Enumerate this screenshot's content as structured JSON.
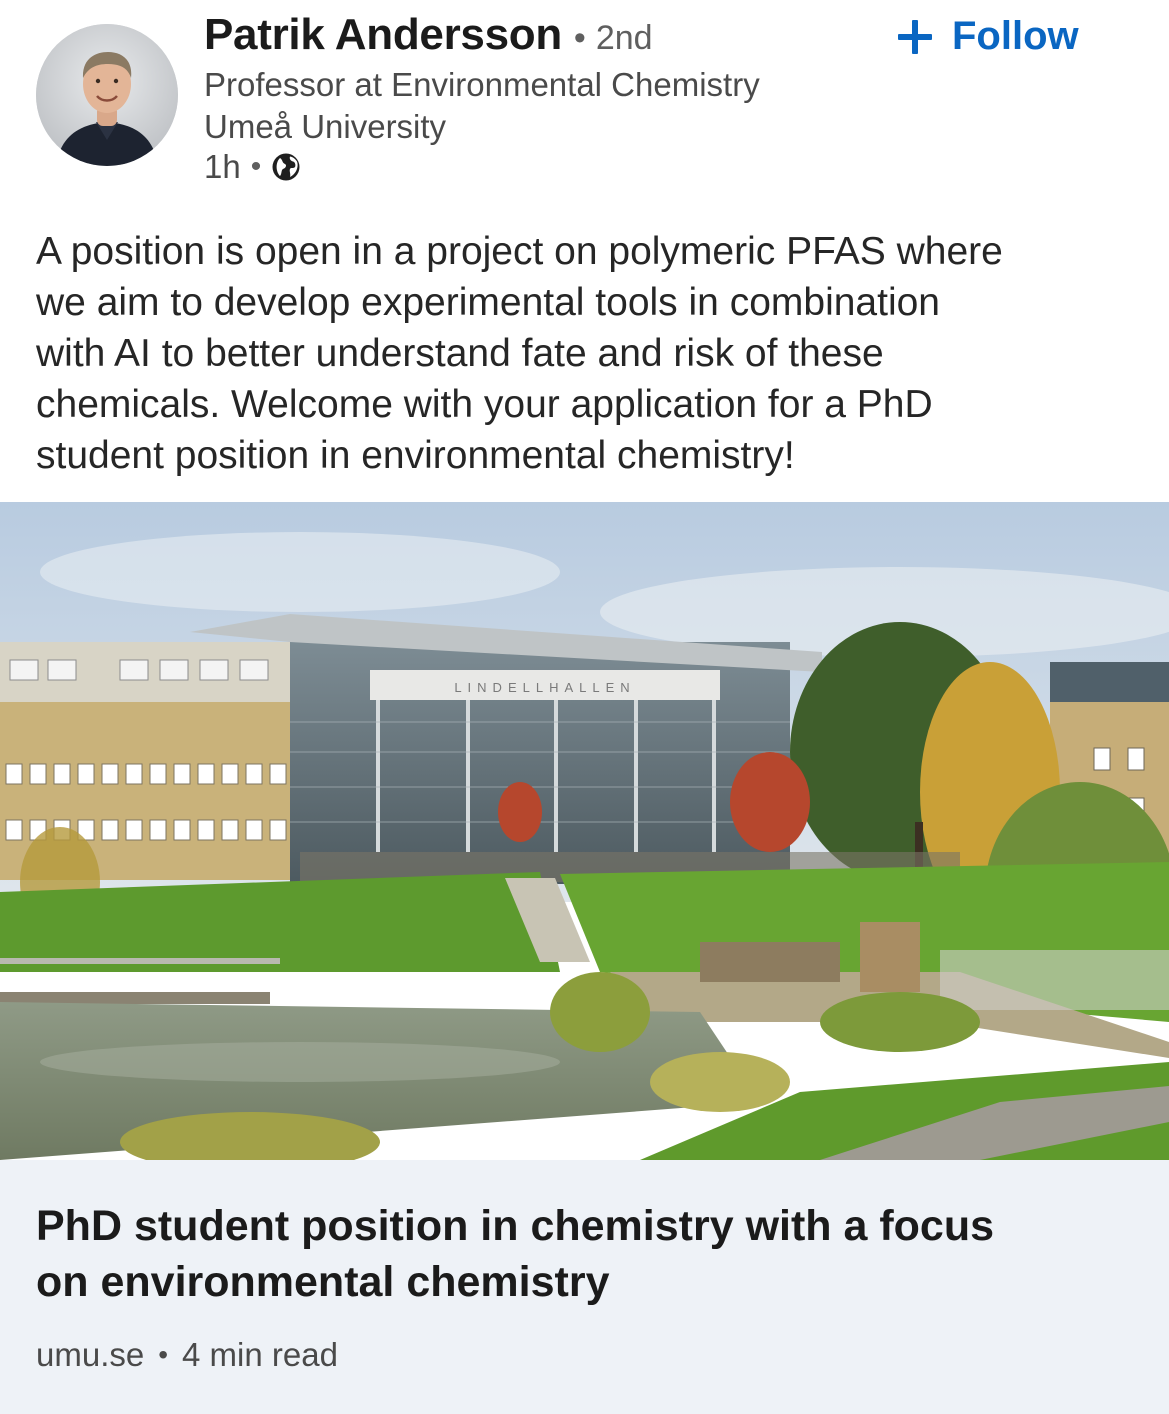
{
  "author": {
    "name": "Patrik Andersson",
    "connection_degree": "2nd",
    "headline_lines": [
      "Professor at Environmental Chemistry",
      "Umeå University"
    ],
    "time_ago": "1h",
    "visibility_icon": "globe-icon"
  },
  "follow_button": {
    "label": "Follow",
    "icon": "plus-icon",
    "color": "#0a66c2"
  },
  "post": {
    "text_lines": [
      "A position is open in a project on polymeric PFAS where",
      "we aim to develop experimental tools in combination",
      "with AI to better understand fate and risk of these",
      "chemicals. Welcome with your application for a PhD",
      "student position in environmental chemistry!"
    ],
    "image_sign_text": "LINDELLHALLEN"
  },
  "link_card": {
    "title_lines": [
      "PhD student position in chemistry with a focus",
      "on environmental chemistry"
    ],
    "domain": "umu.se",
    "read_time": "4 min read",
    "background": "#eef2f7"
  },
  "separator": "•"
}
